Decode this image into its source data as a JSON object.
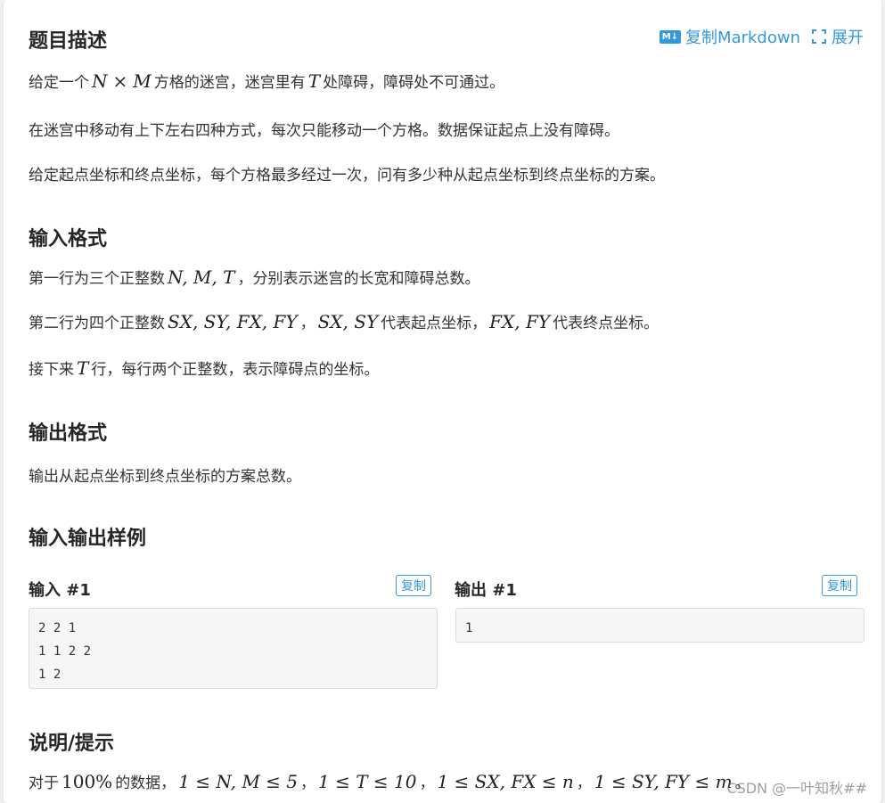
{
  "toolbar": {
    "copy_markdown": "复制Markdown",
    "md_badge": "M↓",
    "expand": "展开"
  },
  "desc": {
    "title": "题目描述",
    "p1": {
      "a": "给定一个",
      "N": "N",
      "times": "×",
      "M": "M",
      "b": "方格的迷宫，迷宫里有",
      "T": "T",
      "c": "处障碍，障碍处不可通过。"
    },
    "p2": "在迷宫中移动有上下左右四种方式，每次只能移动一个方格。数据保证起点上没有障碍。",
    "p3": "给定起点坐标和终点坐标，每个方格最多经过一次，问有多少种从起点坐标到终点坐标的方案。"
  },
  "input_format": {
    "title": "输入格式",
    "l1": {
      "a": "第一行为三个正整数",
      "m": "N, M, T",
      "b": "，分别表示迷宫的长宽和障碍总数。"
    },
    "l2": {
      "a": "第二行为四个正整数",
      "m1": "SX, SY, FX, FY",
      "b": "，",
      "m2": "SX, SY",
      "c": "代表起点坐标，",
      "m3": "FX, FY",
      "d": "代表终点坐标。"
    },
    "l3": {
      "a": "接下来",
      "m": "T",
      "b": "行，每行两个正整数，表示障碍点的坐标。"
    }
  },
  "output_format": {
    "title": "输出格式",
    "text": "输出从起点坐标到终点坐标的方案总数。"
  },
  "samples": {
    "title": "输入输出样例",
    "input_label": "输入 #1",
    "output_label": "输出 #1",
    "copy": "复制",
    "input_data": "2 2 1\n1 1 2 2\n1 2",
    "output_data": "1"
  },
  "hint": {
    "title": "说明/提示",
    "a": "对于",
    "pct": "100%",
    "b": "的数据，",
    "m1": "1 ≤ N, M ≤ 5",
    "c": "，",
    "m2": "1 ≤ T ≤ 10",
    "d": "，",
    "m3": "1 ≤ SX, FX ≤ n",
    "e": "，",
    "m4": "1 ≤ SY, FY ≤ m",
    "f": "。"
  },
  "watermark": "CSDN @一叶知秋##"
}
